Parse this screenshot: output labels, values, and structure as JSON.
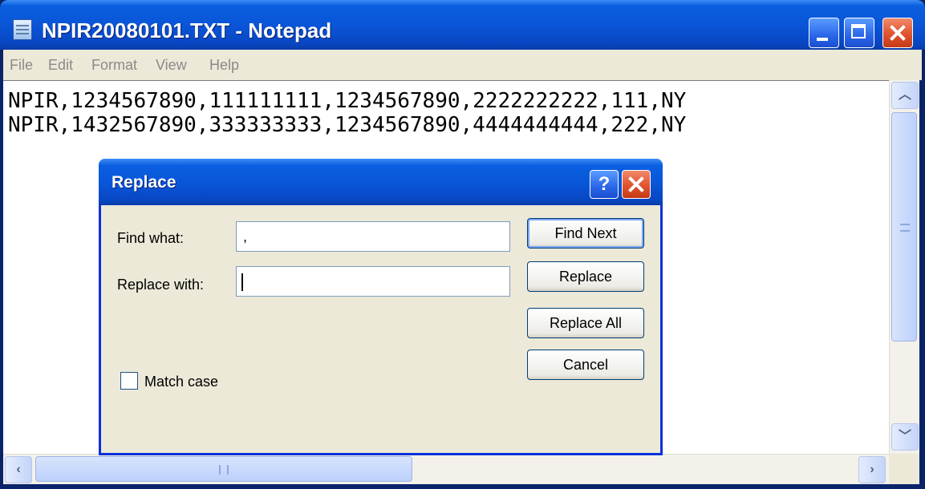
{
  "window": {
    "title": "NPIR20080101.TXT - Notepad",
    "menu": [
      "File",
      "Edit",
      "Format",
      "View",
      "Help"
    ]
  },
  "editor": {
    "lines": [
      "NPIR,1234567890,111111111,1234567890,2222222222,111,NY",
      "NPIR,1432567890,333333333,1234567890,4444444444,222,NY"
    ]
  },
  "dialog": {
    "title": "Replace",
    "help_glyph": "?",
    "find_label": "Find what:",
    "find_value": ",",
    "replace_label": "Replace with:",
    "replace_value": "",
    "match_case_label": "Match case",
    "match_case_checked": false,
    "buttons": {
      "find_next": "Find Next",
      "replace": "Replace",
      "replace_all": "Replace All",
      "cancel": "Cancel"
    }
  },
  "icons": {
    "app": "notepad-icon",
    "minimize": "minimize-icon",
    "maximize": "maximize-icon",
    "close": "close-icon",
    "help": "help-icon"
  }
}
